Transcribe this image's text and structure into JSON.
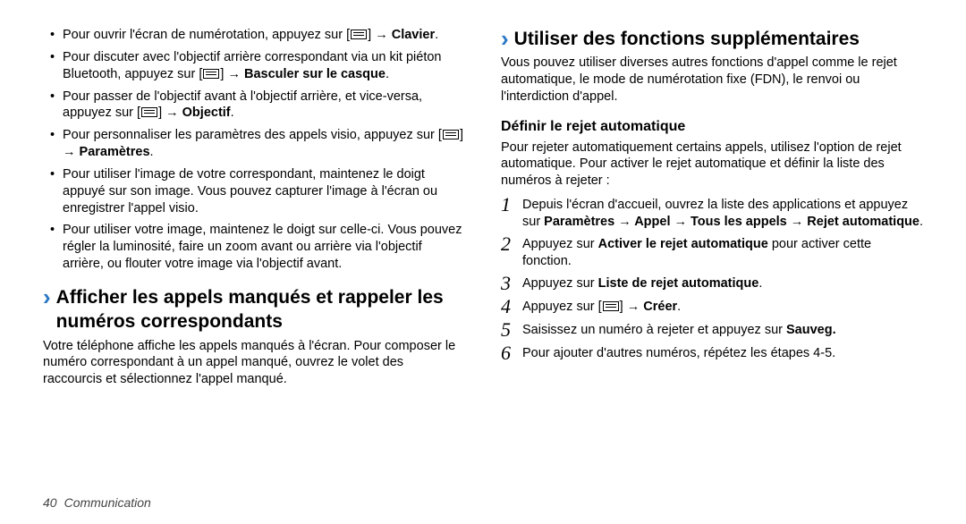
{
  "left": {
    "bullets": [
      {
        "pre": "Pour ouvrir l'écran de numérotation, appuyez sur [",
        "icon": true,
        "mid": "] → ",
        "bold": "Clavier",
        "post": "."
      },
      {
        "pre": "Pour discuter avec l'objectif arrière correspondant via un kit piéton Bluetooth, appuyez sur [",
        "icon": true,
        "mid": "] → ",
        "bold": "Basculer sur le casque",
        "post": "."
      },
      {
        "pre": "Pour passer de l'objectif avant à l'objectif arrière, et vice-versa, appuyez sur [",
        "icon": true,
        "mid": "] → ",
        "bold": "Objectif",
        "post": "."
      },
      {
        "pre": "Pour personnaliser les paramètres des appels visio, appuyez sur [",
        "icon": true,
        "mid": "] → ",
        "bold": "Paramètres",
        "post": "."
      },
      {
        "plain": "Pour utiliser l'image de votre correspondant, maintenez le doigt appuyé sur son image. Vous pouvez capturer l'image à l'écran ou enregistrer l'appel visio."
      },
      {
        "plain": "Pour utiliser votre image, maintenez le doigt sur celle-ci. Vous pouvez régler la luminosité, faire un zoom avant ou arrière via l'objectif arrière, ou flouter votre image via l'objectif avant."
      }
    ],
    "heading": "Afficher les appels manqués et rappeler les numéros correspondants",
    "paragraph": "Votre téléphone affiche les appels manqués à l'écran. Pour composer le numéro correspondant à un appel manqué, ouvrez le volet des raccourcis et sélectionnez l'appel manqué."
  },
  "right": {
    "heading": "Utiliser des fonctions supplémentaires",
    "paragraph1": "Vous pouvez utiliser diverses autres fonctions d'appel comme le rejet automatique, le mode de numérotation fixe (FDN), le renvoi ou l'interdiction d'appel.",
    "subheading": "Définir le rejet automatique",
    "paragraph2": "Pour rejeter automatiquement certains appels, utilisez l'option de rejet automatique. Pour activer le rejet automatique et définir la liste des numéros à rejeter :",
    "steps": [
      {
        "n": "1",
        "pre": "Depuis l'écran d'accueil, ouvrez la liste des applications et appuyez sur ",
        "bold": "Paramètres → Appel → Tous les appels → Rejet automatique",
        "post": "."
      },
      {
        "n": "2",
        "pre": "Appuyez sur ",
        "bold": "Activer le rejet automatique",
        "post": " pour activer cette fonction."
      },
      {
        "n": "3",
        "pre": "Appuyez sur ",
        "bold": "Liste de rejet automatique",
        "post": "."
      },
      {
        "n": "4",
        "preIcon": "Appuyez sur [",
        "icon": true,
        "midIcon": "] → ",
        "boldIcon": "Créer",
        "postIcon": "."
      },
      {
        "n": "5",
        "pre": "Saisissez un numéro à rejeter et appuyez sur ",
        "bold": "Sauveg.",
        "post": ""
      },
      {
        "n": "6",
        "plain": "Pour ajouter d'autres numéros, répétez les étapes 4-5."
      }
    ]
  },
  "footer": {
    "page": "40",
    "section": "Communication"
  }
}
